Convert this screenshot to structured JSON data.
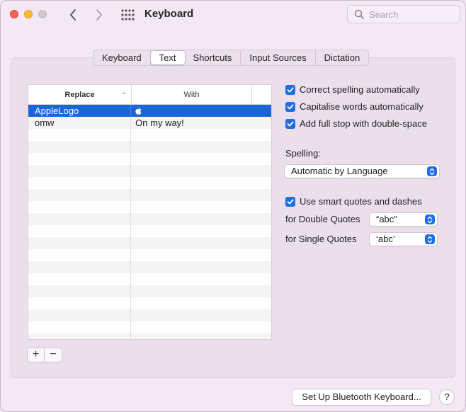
{
  "window": {
    "title": "Keyboard",
    "search_placeholder": "Search"
  },
  "tabs": [
    {
      "label": "Keyboard",
      "active": false
    },
    {
      "label": "Text",
      "active": true
    },
    {
      "label": "Shortcuts",
      "active": false
    },
    {
      "label": "Input Sources",
      "active": false
    },
    {
      "label": "Dictation",
      "active": false
    }
  ],
  "table": {
    "headers": {
      "replace": "Replace",
      "with": "With"
    },
    "rows": [
      {
        "replace": "AppleLogo",
        "with": "",
        "selected": true
      },
      {
        "replace": "omw",
        "with": "On my way!",
        "selected": false
      }
    ]
  },
  "options": {
    "correct_spelling": {
      "label": "Correct spelling automatically",
      "checked": true
    },
    "capitalise_words": {
      "label": "Capitalise words automatically",
      "checked": true
    },
    "full_stop": {
      "label": "Add full stop with double-space",
      "checked": true
    },
    "spelling_label": "Spelling:",
    "spelling_value": "Automatic by Language",
    "smart_quotes": {
      "label": "Use smart quotes and dashes",
      "checked": true
    },
    "double_quotes_label": "for Double Quotes",
    "double_quotes_value": "“abc”",
    "single_quotes_label": "for Single Quotes",
    "single_quotes_value": "‘abc’"
  },
  "footer": {
    "bluetooth_button": "Set Up Bluetooth Keyboard...",
    "help_button": "?"
  },
  "colors": {
    "accent": "#1e6ee8",
    "selection": "#1a66d9",
    "window_bg": "#f3e8f3"
  }
}
